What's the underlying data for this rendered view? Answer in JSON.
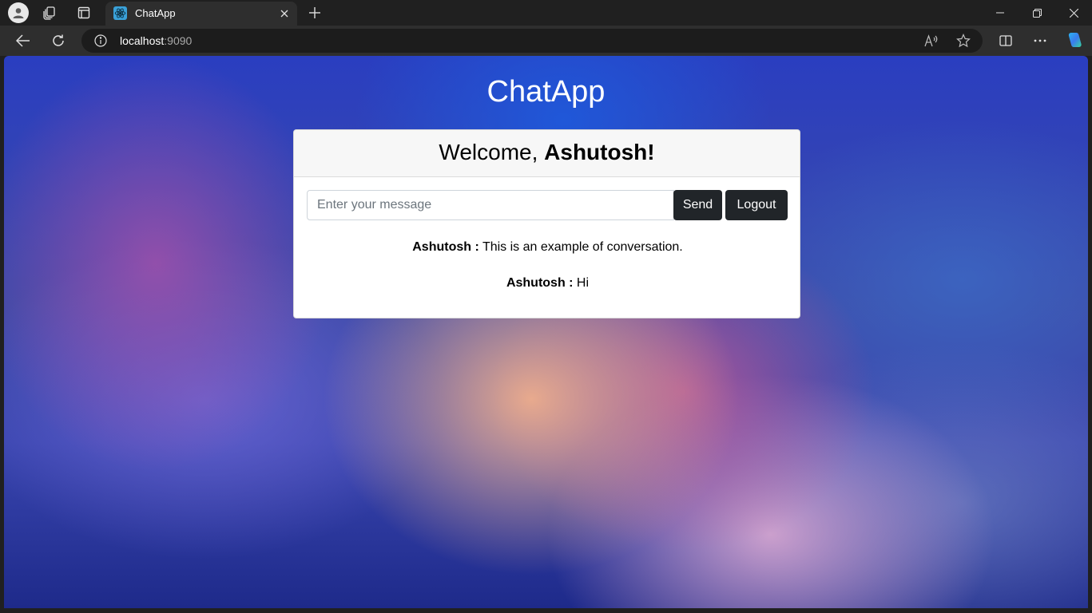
{
  "browser": {
    "tab": {
      "title": "ChatApp"
    },
    "address_bar": {
      "host": "localhost",
      "port": ":9090"
    },
    "icons": [
      "profile-icon",
      "workspaces-icon",
      "tab-actions-icon",
      "react-icon",
      "close-icon",
      "new-tab-icon",
      "minimize-icon",
      "restore-icon",
      "window-close-icon",
      "back-icon",
      "refresh-icon",
      "info-icon",
      "read-aloud-icon",
      "favorite-icon",
      "split-screen-icon",
      "more-icon",
      "copilot-icon"
    ]
  },
  "app": {
    "title": "ChatApp",
    "welcome_prefix": "Welcome, ",
    "username": "Ashutosh!",
    "input": {
      "placeholder": "Enter your message",
      "value": ""
    },
    "send_label": "Send",
    "logout_label": "Logout",
    "messages": [
      {
        "sender": "Ashutosh :",
        "text": " This is an example of conversation."
      },
      {
        "sender": "Ashutosh :",
        "text": " Hi"
      }
    ]
  },
  "colors": {
    "button_bg": "#212529",
    "browser_chrome": "#202020",
    "card_header_bg": "#f7f7f7"
  }
}
